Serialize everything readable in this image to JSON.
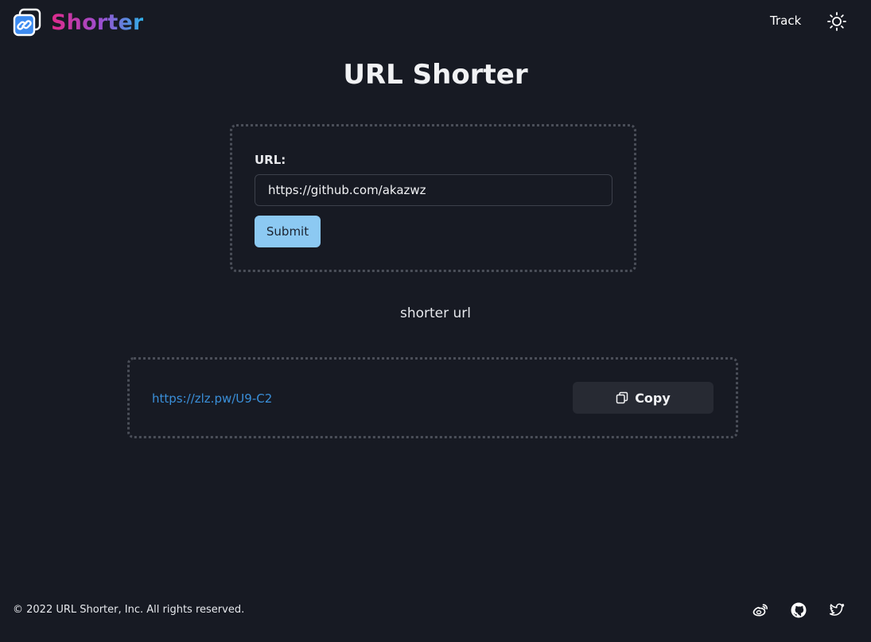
{
  "header": {
    "brand": "Shorter",
    "nav_track": "Track",
    "icons": {
      "logo": "link-logo-icon",
      "theme": "sun-icon"
    }
  },
  "main": {
    "title": "URL Shorter",
    "form": {
      "url_label": "URL:",
      "url_value": "https://github.com/akazwz",
      "submit_label": "Submit"
    },
    "result": {
      "heading": "shorter url",
      "short_url": "https://zlz.pw/U9-C2",
      "copy_label": "Copy",
      "copy_icon": "copy-icon"
    }
  },
  "footer": {
    "copyright": "© 2022 URL Shorter, Inc. All rights reserved.",
    "social_icons": [
      "weibo-icon",
      "github-icon",
      "twitter-icon"
    ]
  },
  "colors": {
    "background": "#171a23",
    "submit_bg": "#8cc9f2",
    "link": "#3a8fd9",
    "brand_gradient": [
      "#e02a8a",
      "#9b4fd1",
      "#2fb0e8"
    ]
  }
}
